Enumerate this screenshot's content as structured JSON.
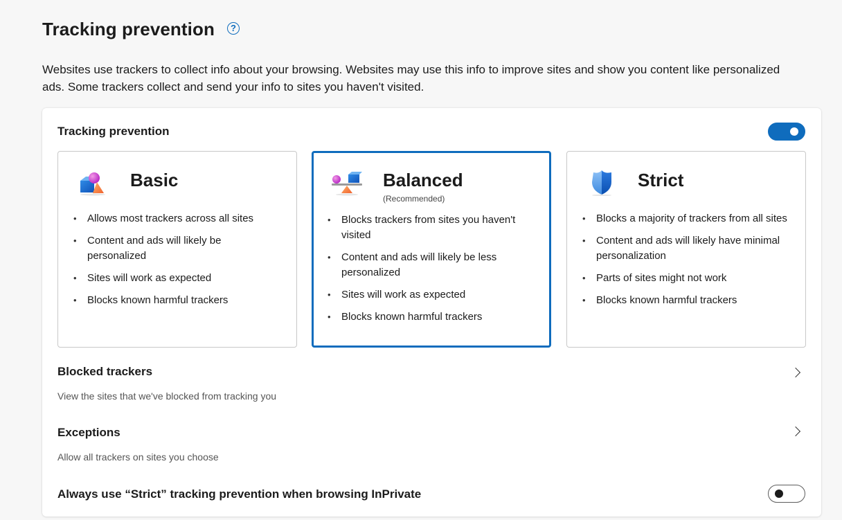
{
  "page": {
    "title": "Tracking prevention",
    "help_icon_glyph": "?",
    "description": "Websites use trackers to collect info about your browsing. Websites may use this info to improve sites and show you content like personalized ads. Some trackers collect and send your info to sites you haven't visited."
  },
  "card": {
    "header": "Tracking prevention",
    "toggle_on": true,
    "options": [
      {
        "title": "Basic",
        "subtitle": "",
        "icon": "basic-shapes-icon",
        "selected": false,
        "bullets": [
          "Allows most trackers across all sites",
          "Content and ads will likely be personalized",
          "Sites will work as expected",
          "Blocks known harmful trackers"
        ]
      },
      {
        "title": "Balanced",
        "subtitle": "(Recommended)",
        "icon": "balance-scale-icon",
        "selected": true,
        "bullets": [
          "Blocks trackers from sites you haven't visited",
          "Content and ads will likely be less personalized",
          "Sites will work as expected",
          "Blocks known harmful trackers"
        ]
      },
      {
        "title": "Strict",
        "subtitle": "",
        "icon": "shield-icon",
        "selected": false,
        "bullets": [
          "Blocks a majority of trackers from all sites",
          "Content and ads will likely have minimal personalization",
          "Parts of sites might not work",
          "Blocks known harmful trackers"
        ]
      }
    ],
    "blocked_trackers": {
      "title": "Blocked trackers",
      "description": "View the sites that we've blocked from tracking you"
    },
    "exceptions": {
      "title": "Exceptions",
      "description": "Allow all trackers on sites you choose"
    },
    "inprivate": {
      "label": "Always use “Strict” tracking prevention when browsing InPrivate",
      "toggle_on": false
    }
  },
  "colors": {
    "accent": "#0f6cbd"
  }
}
